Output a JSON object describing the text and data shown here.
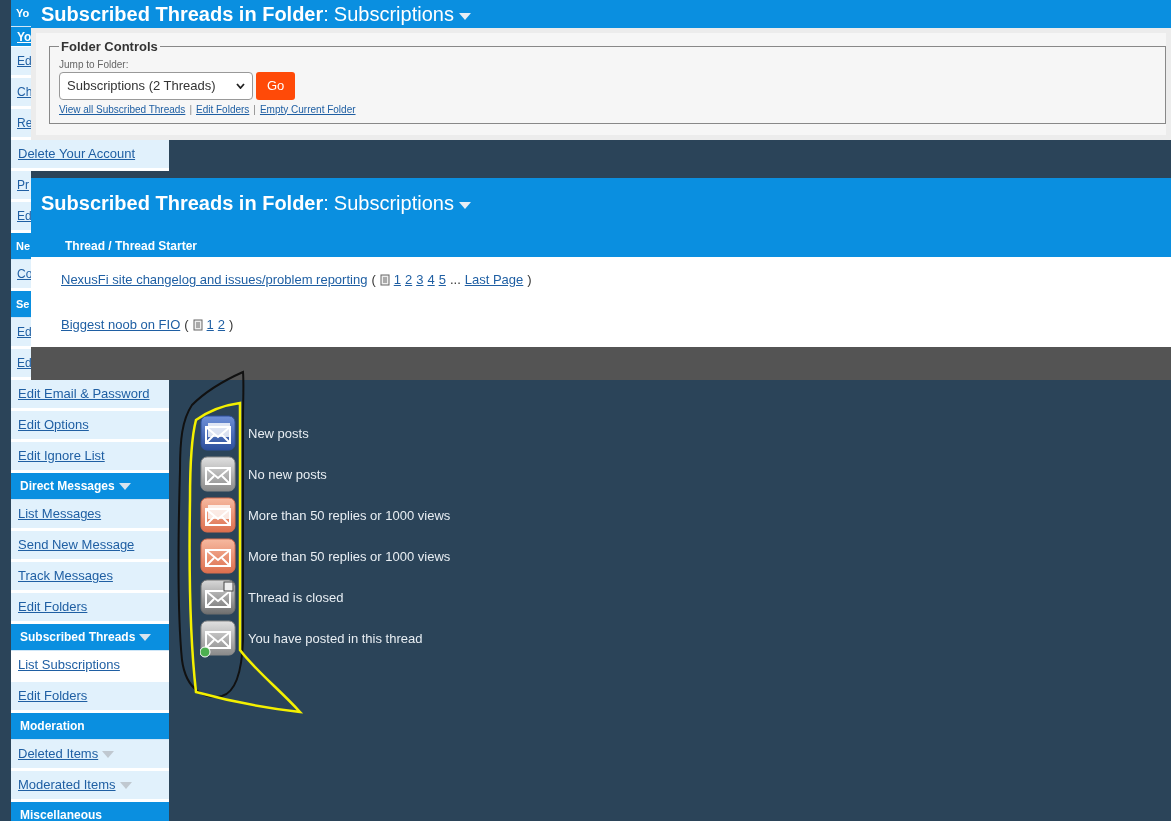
{
  "sidebar": {
    "items": [
      {
        "kind": "header",
        "text": "Yo"
      },
      {
        "kind": "section-link",
        "text": "Yo"
      },
      {
        "kind": "link",
        "text": "Ed",
        "selected": false
      },
      {
        "kind": "link",
        "text": "Ch",
        "selected": false
      },
      {
        "kind": "link",
        "text": "Re",
        "selected": false
      },
      {
        "kind": "link",
        "text": "Delete Your Account",
        "dropdown": false,
        "selected": false
      },
      {
        "kind": "link",
        "text": "Pr",
        "selected": false
      },
      {
        "kind": "link",
        "text": "Ed",
        "selected": false
      },
      {
        "kind": "header",
        "text": "Ne"
      },
      {
        "kind": "link",
        "text": "Co",
        "selected": false
      },
      {
        "kind": "header",
        "text": "Se"
      },
      {
        "kind": "link",
        "text": "Ed",
        "selected": false
      },
      {
        "kind": "link",
        "text": "Ed",
        "selected": false
      },
      {
        "kind": "link",
        "text": "Edit Email & Password",
        "dropdown": false,
        "selected": false
      },
      {
        "kind": "link",
        "text": "Edit Options",
        "dropdown": false,
        "selected": false
      },
      {
        "kind": "link",
        "text": "Edit Ignore List",
        "dropdown": false,
        "selected": false
      },
      {
        "kind": "header",
        "text": "Direct Messages",
        "dropdown": true
      },
      {
        "kind": "link",
        "text": "List Messages",
        "dropdown": false,
        "selected": false
      },
      {
        "kind": "link",
        "text": "Send New Message",
        "dropdown": false,
        "selected": false
      },
      {
        "kind": "link",
        "text": "Track Messages",
        "dropdown": false,
        "selected": false
      },
      {
        "kind": "link",
        "text": "Edit Folders",
        "dropdown": false,
        "selected": false
      },
      {
        "kind": "header",
        "text": "Subscribed Threads",
        "dropdown": true
      },
      {
        "kind": "link",
        "text": "List Subscriptions",
        "dropdown": false,
        "selected": true
      },
      {
        "kind": "link",
        "text": "Edit Folders",
        "dropdown": false,
        "selected": false
      },
      {
        "kind": "header",
        "text": "Moderation",
        "dropdown": false
      },
      {
        "kind": "link",
        "text": "Deleted Items",
        "dropdown": true,
        "selected": false
      },
      {
        "kind": "link",
        "text": "Moderated Items",
        "dropdown": true,
        "selected": false
      },
      {
        "kind": "header",
        "text": "Miscellaneous",
        "dropdown": false
      }
    ]
  },
  "top_panel": {
    "title": "Subscribed Threads in Folder",
    "colon": ":",
    "folder": "Subscriptions",
    "legend": "Folder Controls",
    "jump_label": "Jump to Folder:",
    "select_value": "Subscriptions (2 Threads)",
    "go_button": "Go",
    "separator": "|",
    "links": [
      "View all Subscribed Threads",
      "Edit Folders",
      "Empty Current Folder"
    ]
  },
  "thread_panel": {
    "title": "Subscribed Threads in Folder",
    "colon": ":",
    "folder": "Subscriptions",
    "column": "Thread / Thread Starter",
    "open_paren": "(",
    "close_paren": ")",
    "rows": [
      {
        "title": "NexusFi site changelog and issues/problem reporting",
        "pages": [
          "1",
          "2",
          "3",
          "4",
          "5"
        ],
        "ellipsis": "...",
        "last_page": "Last Page"
      },
      {
        "title": "Biggest noob on FIO",
        "pages": [
          "1",
          "2"
        ]
      }
    ]
  },
  "legend": [
    {
      "kind": "new",
      "label": "New posts"
    },
    {
      "kind": "no-new",
      "label": "No new posts"
    },
    {
      "kind": "hot-new",
      "label": "More than 50 replies or 1000 views"
    },
    {
      "kind": "hot",
      "label": "More than 50 replies or 1000 views"
    },
    {
      "kind": "closed",
      "label": "Thread is closed"
    },
    {
      "kind": "posted",
      "label": "You have posted in this thread"
    }
  ]
}
